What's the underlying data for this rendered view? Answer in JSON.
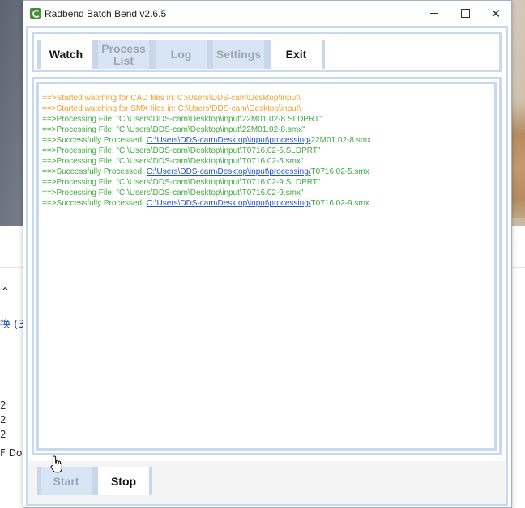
{
  "window": {
    "title": "Radbend Batch Bend v2.6.5",
    "controls": {
      "minimize": "minimize",
      "maximize": "maximize",
      "close": "✕"
    }
  },
  "tabs": [
    {
      "label": "Watch",
      "state": "selected"
    },
    {
      "label": "Process List",
      "state": "disabled"
    },
    {
      "label": "Log",
      "state": "disabled"
    },
    {
      "label": "Settings",
      "state": "disabled"
    },
    {
      "label": "Exit",
      "state": "active"
    }
  ],
  "log": [
    {
      "color": "#f0a030",
      "prefix": "==>Started watching for CAD files in: C:\\Users\\DDS-cam\\Desktop\\input\\",
      "link": "",
      "suffix": ""
    },
    {
      "color": "#f0a030",
      "prefix": "==>Started watching for SMX files in: C:\\Users\\DDS-cam\\Desktop\\input\\",
      "link": "",
      "suffix": ""
    },
    {
      "color": "#3faa3f",
      "prefix": "==>Processing File: \"C:\\Users\\DDS-cam\\Desktop\\input\\22M01.02-8.SLDPRT\"",
      "link": "",
      "suffix": ""
    },
    {
      "color": "#3faa3f",
      "prefix": "==>Processing File: \"C:\\Users\\DDS-cam\\Desktop\\input\\22M01.02-8.smx\"",
      "link": "",
      "suffix": ""
    },
    {
      "color": "#3faa3f",
      "prefix": "==>Successfully Processed: ",
      "link": "C:\\Users\\DDS-cam\\Desktop\\input\\processing\\",
      "suffix": "22M01.02-8.smx"
    },
    {
      "color": "#3faa3f",
      "prefix": "==>Processing File: \"C:\\Users\\DDS-cam\\Desktop\\input\\T0716.02-5.SLDPRT\"",
      "link": "",
      "suffix": ""
    },
    {
      "color": "#3faa3f",
      "prefix": "==>Processing File: \"C:\\Users\\DDS-cam\\Desktop\\input\\T0716.02-5.smx\"",
      "link": "",
      "suffix": ""
    },
    {
      "color": "#3faa3f",
      "prefix": "==>Successfully Processed: ",
      "link": "C:\\Users\\DDS-cam\\Desktop\\input\\processing\\",
      "suffix": "T0716.02-5.smx"
    },
    {
      "color": "#3faa3f",
      "prefix": "==>Processing File: \"C:\\Users\\DDS-cam\\Desktop\\input\\T0716.02-9.SLDPRT\"",
      "link": "",
      "suffix": ""
    },
    {
      "color": "#3faa3f",
      "prefix": "==>Processing File: \"C:\\Users\\DDS-cam\\Desktop\\input\\T0716.02-9.smx\"",
      "link": "",
      "suffix": ""
    },
    {
      "color": "#3faa3f",
      "prefix": "==>Successfully Processed: ",
      "link": "C:\\Users\\DDS-cam\\Desktop\\input\\processing\\",
      "suffix": "T0716.02-9.smx"
    }
  ],
  "buttons": {
    "start": "Start",
    "stop": "Stop"
  },
  "background": {
    "chevron": "^",
    "item_text": "换 (3",
    "list_values": [
      "2",
      "2",
      "2"
    ],
    "partial_text": "F Do"
  },
  "colors": {
    "border": "#c7d9ef",
    "disabled_fill": "#d7e5f5",
    "log_orange": "#f0a030",
    "log_green": "#3faa3f",
    "link_blue": "#2255c4"
  }
}
